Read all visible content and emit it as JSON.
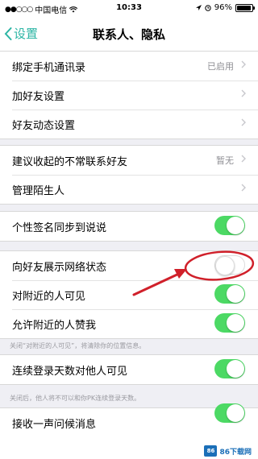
{
  "status_bar": {
    "carrier": "中国电信",
    "time": "10:33",
    "battery": "96%",
    "battery_level": 0.96
  },
  "nav": {
    "back_label": "设置",
    "title": "联系人、隐私"
  },
  "group1": {
    "items": [
      {
        "label": "绑定手机通讯录",
        "value": "已启用"
      },
      {
        "label": "加好友设置"
      },
      {
        "label": "好友动态设置"
      }
    ]
  },
  "group2": {
    "items": [
      {
        "label": "建议收起的不常联系好友",
        "value": "暂无"
      },
      {
        "label": "管理陌生人"
      }
    ]
  },
  "group3": {
    "items": [
      {
        "label": "个性签名同步到说说",
        "state": "on"
      }
    ]
  },
  "group4": {
    "items": [
      {
        "label": "向好友展示网络状态",
        "state": "off"
      },
      {
        "label": "对附近的人可见",
        "state": "on"
      },
      {
        "label": "允许附近的人赞我",
        "state": "on"
      }
    ],
    "footnote": "关闭“对附近的人可见”，将清除你的位置信息。"
  },
  "group5": {
    "items": [
      {
        "label": "连续登录天数对他人可见",
        "state": "on"
      }
    ],
    "footnote": "关闭后，他人将不可以和你PK连续登录天数。"
  },
  "group6": {
    "items": [
      {
        "label": "接收一声问候消息",
        "state": "on"
      }
    ]
  },
  "watermark": {
    "logo_text": "86",
    "text": "86下载网"
  },
  "colors": {
    "accent": "#2bb5a4",
    "toggle_on": "#4cd964",
    "annotation": "#d0202a"
  }
}
